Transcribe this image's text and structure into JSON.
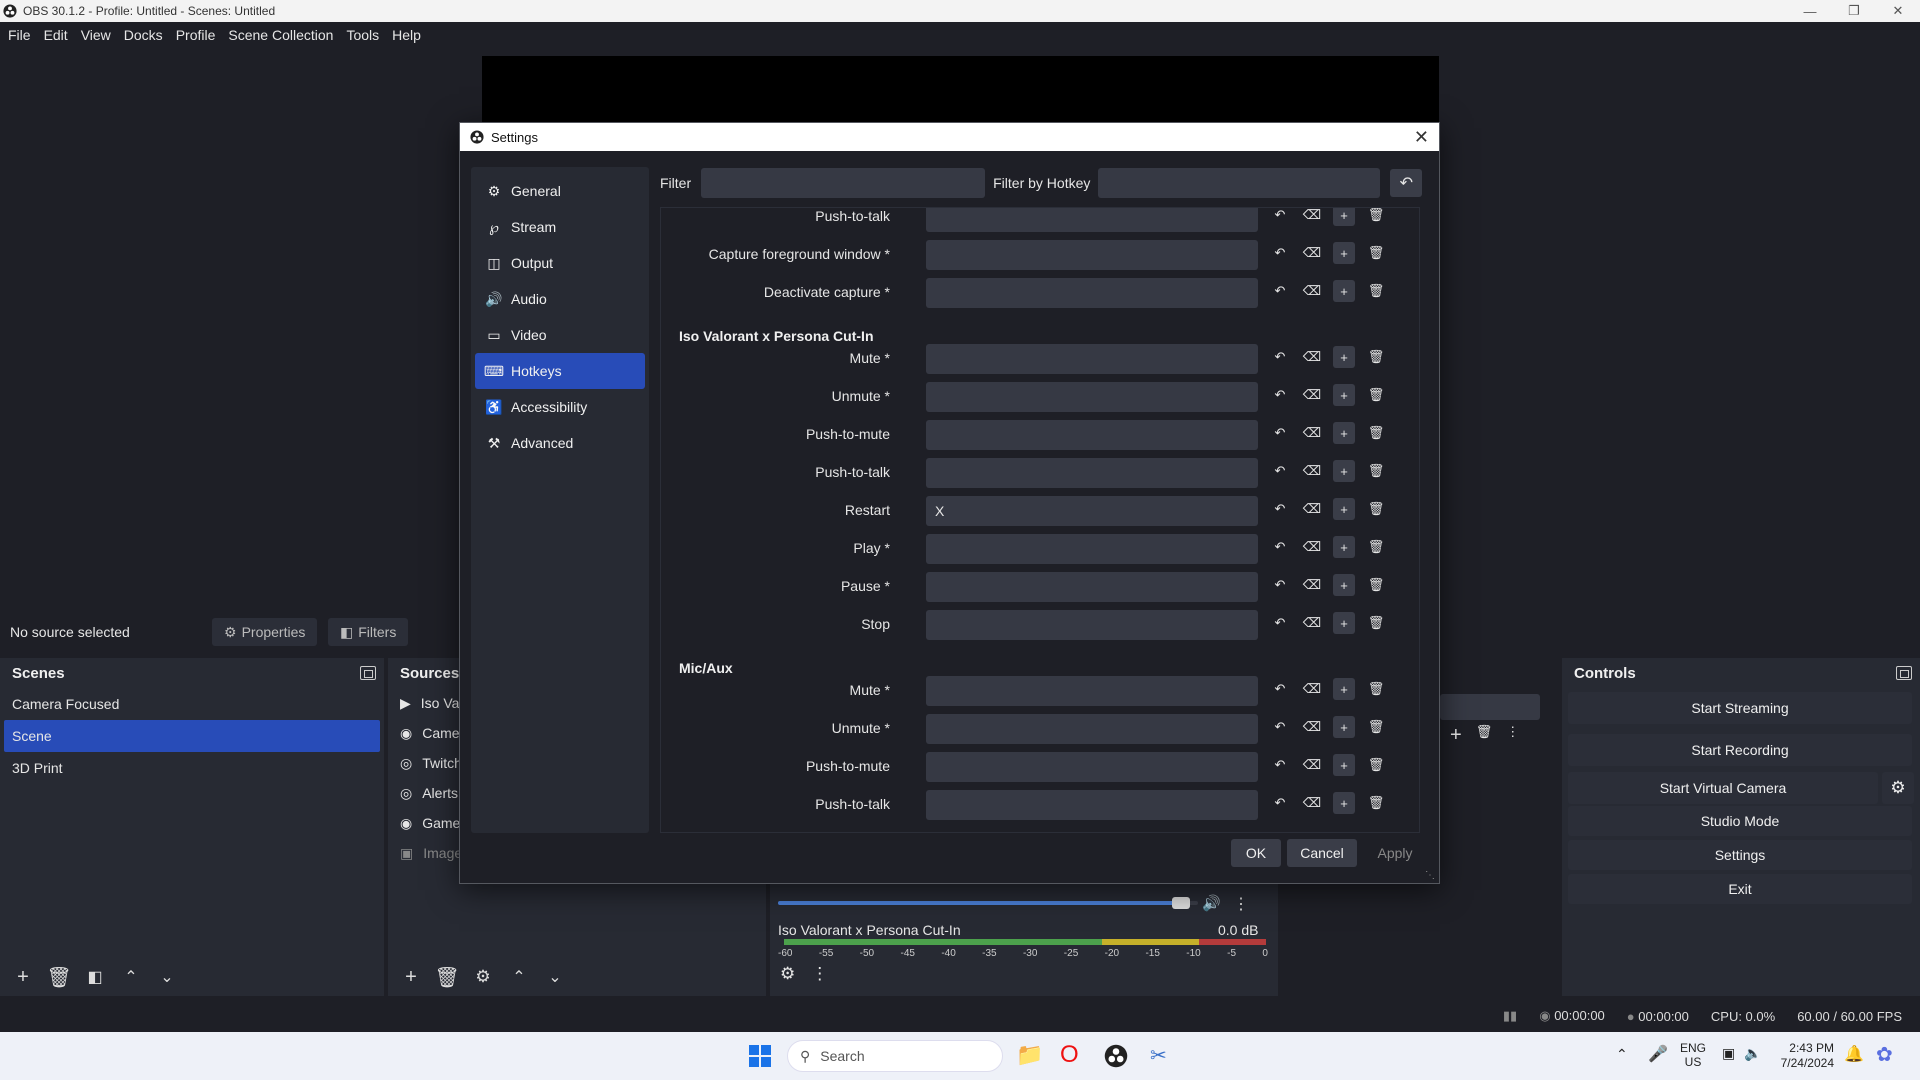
{
  "window": {
    "title": "OBS 30.1.2 - Profile: Untitled - Scenes: Untitled"
  },
  "menu": [
    "File",
    "Edit",
    "View",
    "Docks",
    "Profile",
    "Scene Collection",
    "Tools",
    "Help"
  ],
  "source_bar": {
    "no_source": "No source selected",
    "properties": "Properties",
    "filters": "Filters"
  },
  "scenes": {
    "title": "Scenes",
    "items": [
      "Camera Focused",
      "Scene",
      "3D Print"
    ],
    "selected": "Scene"
  },
  "sources": {
    "title": "Sources",
    "items": [
      "Iso Va",
      "Camer",
      "Twitch",
      "Alerts",
      "Game",
      "Image"
    ]
  },
  "mixer": {
    "source_name": "Iso Valorant x Persona Cut-In",
    "db": "0.0 dB",
    "ticks": [
      "-60",
      "-55",
      "-50",
      "-45",
      "-40",
      "-35",
      "-30",
      "-25",
      "-20",
      "-15",
      "-10",
      "-5",
      "0"
    ],
    "volume_level": 0.98
  },
  "controls": {
    "title": "Controls",
    "start_streaming": "Start Streaming",
    "start_recording": "Start Recording",
    "start_virtual_camera": "Start Virtual Camera",
    "studio_mode": "Studio Mode",
    "settings": "Settings",
    "exit": "Exit"
  },
  "status": {
    "stream_time": "00:00:00",
    "record_time": "00:00:00",
    "cpu": "CPU: 0.0%",
    "fps": "60.00 / 60.00 FPS"
  },
  "taskbar": {
    "search": "Search",
    "lang1": "ENG",
    "lang2": "US",
    "time": "2:43 PM",
    "date": "7/24/2024"
  },
  "settings": {
    "title": "Settings",
    "nav": [
      "General",
      "Stream",
      "Output",
      "Audio",
      "Video",
      "Hotkeys",
      "Accessibility",
      "Advanced"
    ],
    "active_nav": "Hotkeys",
    "filter_label": "Filter",
    "filter_hotkey_label": "Filter by Hotkey",
    "rows": [
      {
        "type": "row",
        "label": "Push-to-talk",
        "value": ""
      },
      {
        "type": "row",
        "label": "Capture foreground window *",
        "value": ""
      },
      {
        "type": "row",
        "label": "Deactivate capture *",
        "value": ""
      },
      {
        "type": "section",
        "label": "Iso Valorant x Persona Cut-In"
      },
      {
        "type": "row",
        "label": "Mute *",
        "value": ""
      },
      {
        "type": "row",
        "label": "Unmute *",
        "value": ""
      },
      {
        "type": "row",
        "label": "Push-to-mute",
        "value": ""
      },
      {
        "type": "row",
        "label": "Push-to-talk",
        "value": ""
      },
      {
        "type": "row",
        "label": "Restart",
        "value": "X"
      },
      {
        "type": "row",
        "label": "Play *",
        "value": ""
      },
      {
        "type": "row",
        "label": "Pause *",
        "value": ""
      },
      {
        "type": "row",
        "label": "Stop",
        "value": ""
      },
      {
        "type": "section",
        "label": "Mic/Aux"
      },
      {
        "type": "row",
        "label": "Mute *",
        "value": ""
      },
      {
        "type": "row",
        "label": "Unmute *",
        "value": ""
      },
      {
        "type": "row",
        "label": "Push-to-mute",
        "value": ""
      },
      {
        "type": "row",
        "label": "Push-to-talk",
        "value": ""
      }
    ],
    "ok": "OK",
    "cancel": "Cancel",
    "apply": "Apply"
  }
}
